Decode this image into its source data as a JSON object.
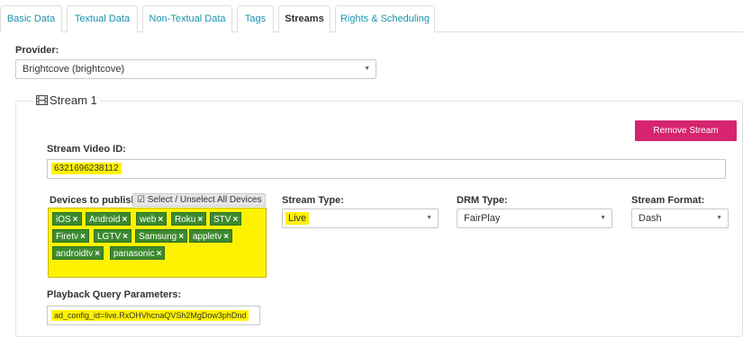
{
  "tabs": [
    {
      "label": "Basic Data",
      "active": false
    },
    {
      "label": "Textual Data",
      "active": false
    },
    {
      "label": "Non-Textual Data",
      "active": false
    },
    {
      "label": "Tags",
      "active": false
    },
    {
      "label": "Streams",
      "active": true
    },
    {
      "label": "Rights & Scheduling",
      "active": false
    }
  ],
  "provider": {
    "label": "Provider:",
    "value": "Brightcove (brightcove)"
  },
  "stream": {
    "legend": "Stream 1",
    "remove_label": "Remove Stream",
    "video_id_label": "Stream Video ID:",
    "video_id_value": "6321696238112",
    "devices_label": "Devices to publish:",
    "toggle_all_label": "Select / Unselect All Devices",
    "devices": [
      "iOS",
      "Android",
      "web",
      "Roku",
      "STV",
      "Firetv",
      "LGTV",
      "Samsung",
      "appletv",
      "androidtv",
      "panasonic"
    ],
    "stream_type_label": "Stream Type:",
    "stream_type_value": "Live",
    "drm_type_label": "DRM Type:",
    "drm_type_value": "FairPlay",
    "stream_format_label": "Stream Format:",
    "stream_format_value": "Dash",
    "playback_label": "Playback Query Parameters:",
    "playback_value": "ad_config_id=live.RxOHVhcnaQVSh2MgDow3phDnd"
  },
  "colors": {
    "tab_text": "#1a93ad",
    "remove_button": "#d6246e",
    "highlight": "#fff200",
    "device_tag": "#3c8a2e"
  },
  "icons": {
    "legend": "film-icon",
    "toggle_all": "checkbox-checked-icon",
    "dropdown": "chevron-down-icon",
    "tag_remove": "close-icon"
  }
}
